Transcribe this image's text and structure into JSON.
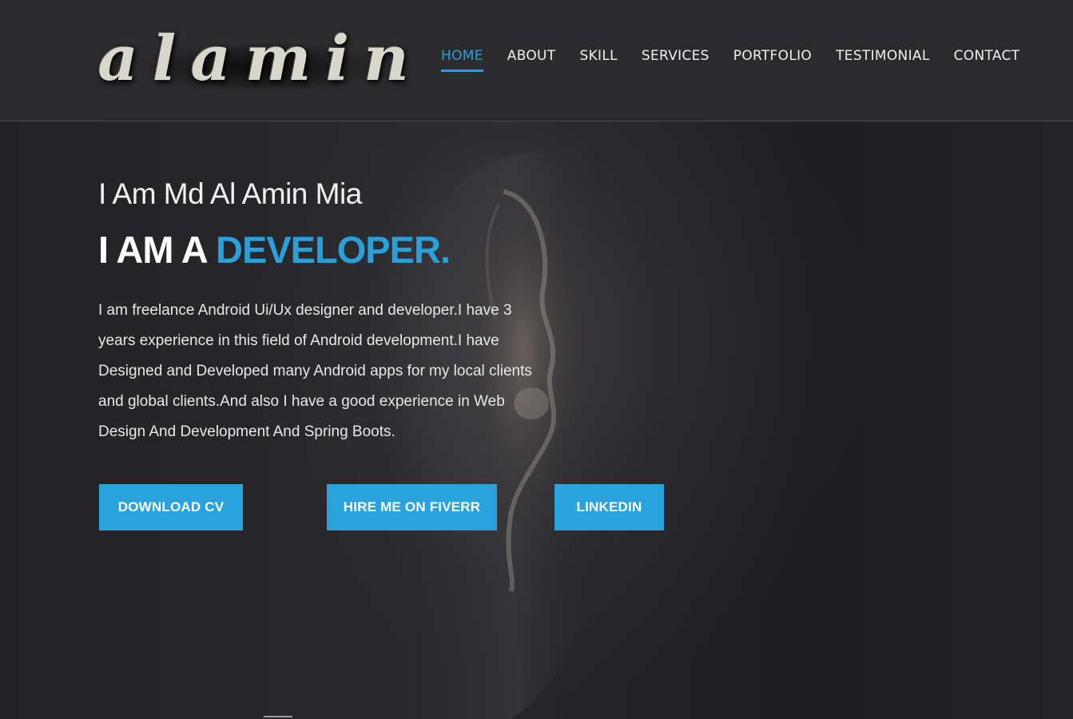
{
  "logo": {
    "text": "alamin"
  },
  "nav": {
    "items": [
      {
        "label": "HOME",
        "active": true
      },
      {
        "label": "ABOUT",
        "active": false
      },
      {
        "label": "SKILL",
        "active": false
      },
      {
        "label": "SERVICES",
        "active": false
      },
      {
        "label": "PORTFOLIO",
        "active": false
      },
      {
        "label": "TESTIMONIAL",
        "active": false
      },
      {
        "label": "CONTACT",
        "active": false
      }
    ]
  },
  "hero": {
    "name": "I Am Md Al Amin Mia",
    "role_prefix": "I AM A ",
    "role_highlight": "DEVELOPER.",
    "description": "I am freelance Android Ui/Ux designer and developer.I have 3 years experience in this field of Android development.I have Designed and Developed many Android apps for my local clients and global clients.And also I have a good experience in Web Design And Development And Spring Boots.",
    "buttons": {
      "download_cv": "DOWNLOAD CV",
      "fiverr": "HIRE ME ON FIVERR",
      "linkedin": "LINKEDIN"
    }
  },
  "colors": {
    "accent": "#2a9fd8",
    "header_bg": "#2c2c30",
    "page_bg": "#232326"
  },
  "icons": {
    "background": "portrait-photo"
  }
}
